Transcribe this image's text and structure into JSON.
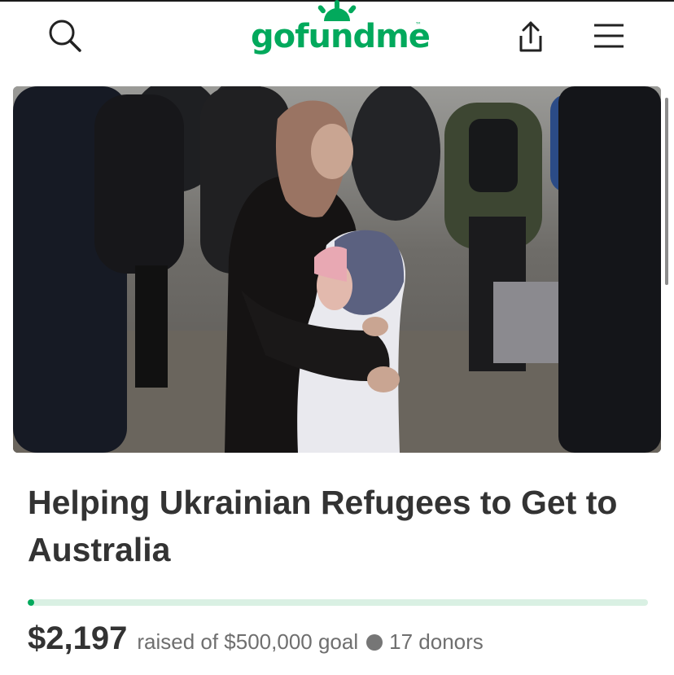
{
  "header": {
    "brand": "gofundme",
    "brand_mark": "™",
    "icons": {
      "search": "search-icon",
      "share": "share-icon",
      "menu": "hamburger-menu-icon",
      "logo_sun": "sun-rays-icon"
    }
  },
  "campaign": {
    "image_subject": "elderly woman hugging a child among a crowd of refugees",
    "title": "Helping Ukrainian Refugees to Get to Australia",
    "amount_raised": "$2,197",
    "goal_text": "raised of $500,000 goal",
    "donors_text": "17 donors",
    "progress_fraction": 0.0044
  },
  "colors": {
    "brand_green": "#02a95c",
    "progress_track": "#d9f0e3",
    "title_text": "#333333",
    "secondary_text": "#6f6f6f"
  }
}
